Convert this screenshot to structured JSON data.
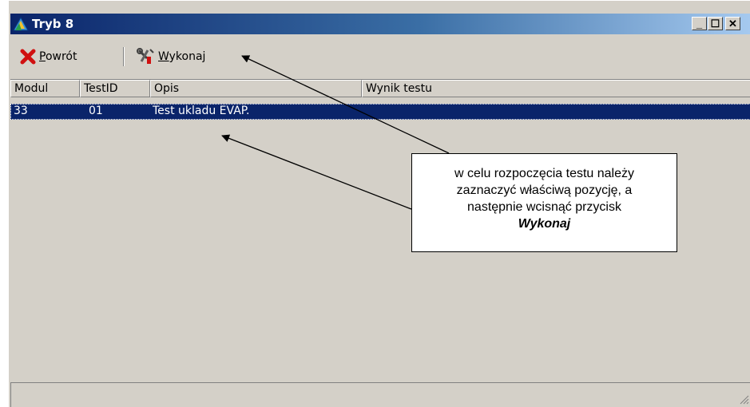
{
  "window": {
    "title": "Tryb 8"
  },
  "icons": {
    "app": "app-triangle-icon",
    "back": "red-x-icon",
    "execute": "tools-icon"
  },
  "toolbar": {
    "back_label": "Powrót",
    "execute_label": "Wykonaj"
  },
  "table": {
    "headers": [
      "Modul",
      "TestID",
      "Opis",
      "Wynik testu"
    ],
    "rows": [
      {
        "modul": "33",
        "testid": "01",
        "opis": "Test ukladu EVAP.",
        "wynik": ""
      }
    ]
  },
  "callout": {
    "line1": "w celu rozpoczęcia testu należy",
    "line2": "zaznaczyć właściwą pozycję, a",
    "line3": "następnie wcisnąć przycisk",
    "line4": "Wykonaj"
  },
  "colors": {
    "titlebar_start": "#0a246a",
    "titlebar_end": "#a6caf0",
    "selection": "#0a246a",
    "face": "#d4d0c8"
  }
}
